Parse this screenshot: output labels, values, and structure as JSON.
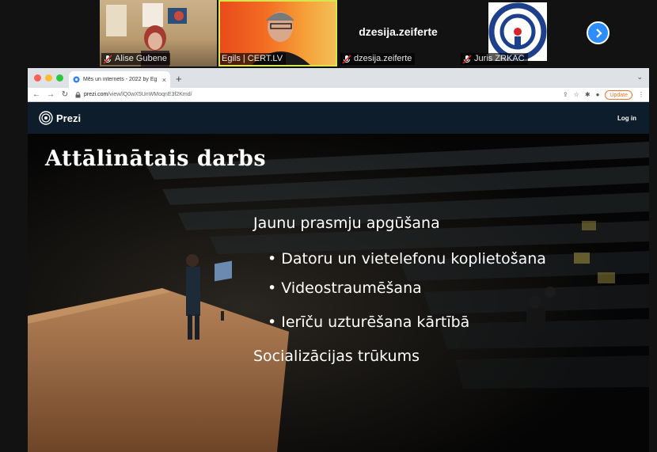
{
  "participants": [
    {
      "name": "Alise Gubene"
    },
    {
      "name": "Egils | CERT.LV"
    },
    {
      "name": "dzesija.zeiferte",
      "display": "dzesija.zeiferte"
    },
    {
      "name": "Juris ZRKAC"
    }
  ],
  "browser": {
    "tab_title": "Mēs un internets - 2022 by Eg",
    "url_host": "prezi.com",
    "url_path": "/view/lQ0wX5UnWMoqnE3f2Kmd/",
    "update_label": "Update"
  },
  "prezi": {
    "brand": "Prezi",
    "login": "Log in"
  },
  "slide": {
    "title": "Attālinātais darbs",
    "lines": [
      "Jaunu prasmju apgūšana",
      "• Datoru un vietelefonu koplietošana",
      "• Videostraumēšana",
      "• Ierīču uzturēšana kārtībā",
      "Socializācijas trūkums"
    ]
  },
  "colors": {
    "zoom_blue": "#2d8cff",
    "active_speaker": "#d8e64a",
    "prezi_header": "#0e1d2b",
    "update_orange": "#e07a2f"
  },
  "icons": [
    "mic-off-icon",
    "next-page-icon",
    "back-icon",
    "forward-icon",
    "reload-icon",
    "lock-icon",
    "share-icon",
    "bookmark-star-icon",
    "extensions-icon",
    "profile-icon",
    "prezi-logo-icon"
  ]
}
